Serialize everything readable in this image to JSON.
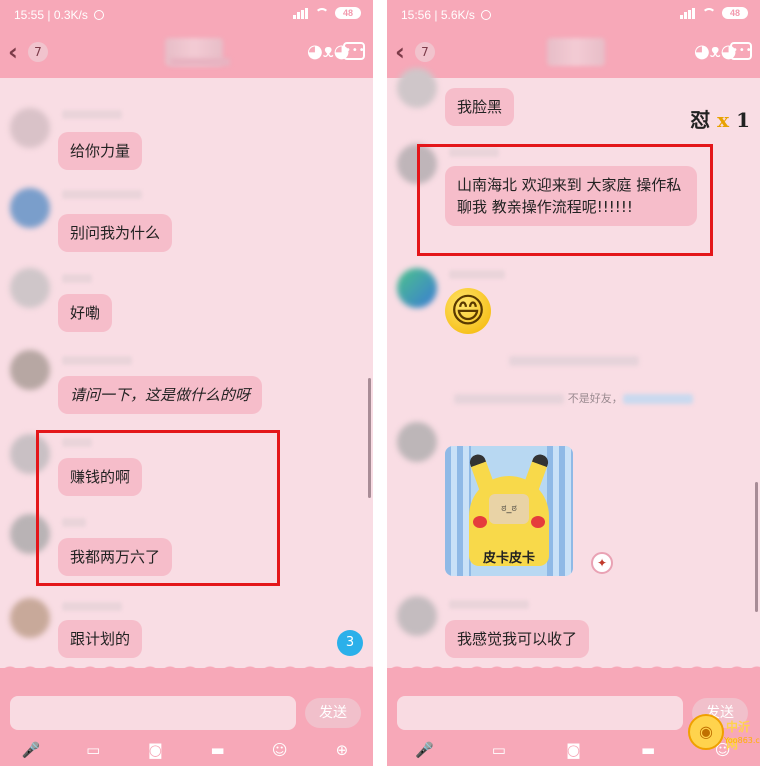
{
  "left": {
    "status": {
      "time": "15:55",
      "speed": "0.3K/s",
      "battery": "48"
    },
    "nav": {
      "back": "‹",
      "unread": "7"
    },
    "messages": [
      {
        "text": "给你力量"
      },
      {
        "text": "别问我为什么"
      },
      {
        "text": "好嘞"
      },
      {
        "text": "请问一下，这是做什么的呀"
      },
      {
        "text": "赚钱的啊"
      },
      {
        "text": "我都两万六了"
      },
      {
        "text": "跟计划的"
      }
    ],
    "floating_unread": "3",
    "input": {
      "send": "发送"
    }
  },
  "right": {
    "status": {
      "time": "15:56",
      "speed": "5.6K/s",
      "battery": "48"
    },
    "nav": {
      "back": "‹",
      "unread": "7"
    },
    "hit_label": {
      "a": "怼",
      "x": "x",
      "n": "1"
    },
    "messages": [
      {
        "text": "我脸黑"
      },
      {
        "text": "山南海北   欢迎来到          大家庭      操作私聊我  教亲操作流程呢!!!!!!"
      },
      {
        "text": "我感觉我可以收了"
      }
    ],
    "emoji": "😄",
    "system_line2_visible": "不是好友，",
    "sticker_caption": "皮卡皮卡",
    "input": {
      "send": "发送"
    }
  },
  "watermark": {
    "logo": "◉",
    "name": "中沂网",
    "url": "Yoo863.com"
  },
  "colors": {
    "bar": "#f7a8b8",
    "bg": "#f9dde4",
    "bubble": "#f6bdca",
    "highlight": "#e4161a"
  },
  "icons": [
    "back-chevron-icon",
    "cat-face-icon",
    "group-chat-icon",
    "mic-icon",
    "image-icon",
    "camera-icon",
    "folder-icon",
    "emoji-icon",
    "plus-icon"
  ]
}
